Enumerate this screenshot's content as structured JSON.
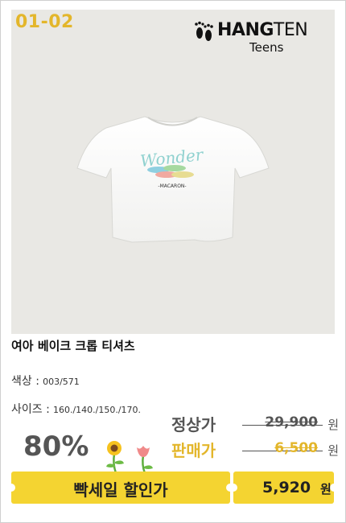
{
  "product": {
    "code": "01-02",
    "brand": "HANG",
    "brand_suffix": "TEN",
    "sub_brand": "Teens",
    "name": "여아 베이크 크롭 티셔츠",
    "color_label": "색상 :",
    "color_value": "003/571",
    "size_label": "사이즈 :",
    "size_value": "160./140./150./170.",
    "shirt_print_script": "Wonder",
    "shirt_print_caption": "-MACARON-"
  },
  "pricing": {
    "regular_label": "정상가",
    "regular_value": "29,900",
    "sale_label": "판매가",
    "sale_value": "6,500",
    "unit": "원",
    "discount": "80%",
    "flash_label": "빡세일 할인가",
    "flash_value": "5,920",
    "flash_unit": "원"
  },
  "colors": {
    "accent_yellow": "#f4d431",
    "code_gold": "#e3b62b",
    "photo_bg": "#e9e8e4"
  },
  "icons": [
    "footprints-logo-icon",
    "sunflower-icon",
    "tulip-icon"
  ]
}
